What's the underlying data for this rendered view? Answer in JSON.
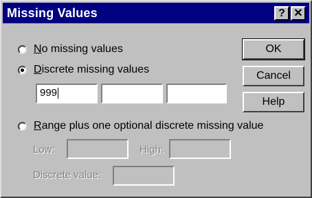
{
  "window": {
    "title": "Missing Values",
    "help_glyph": "?",
    "close_glyph": "✕"
  },
  "options": {
    "no_missing": {
      "label_key": "N",
      "label_rest": "o missing values",
      "checked": false
    },
    "discrete": {
      "label_key": "D",
      "label_rest": "iscrete missing values",
      "checked": true
    },
    "range": {
      "label_key": "R",
      "label_rest": "ange plus one optional discrete missing value",
      "checked": false
    }
  },
  "discrete_fields": {
    "value1": "999",
    "value2": "",
    "value3": ""
  },
  "range_fields": {
    "low_label": "Low:",
    "high_label": "High:",
    "discrete_label": "Discrete value:",
    "low_value": "",
    "high_value": "",
    "discrete_value": ""
  },
  "buttons": {
    "ok": "OK",
    "cancel": "Cancel",
    "help": "Help"
  }
}
